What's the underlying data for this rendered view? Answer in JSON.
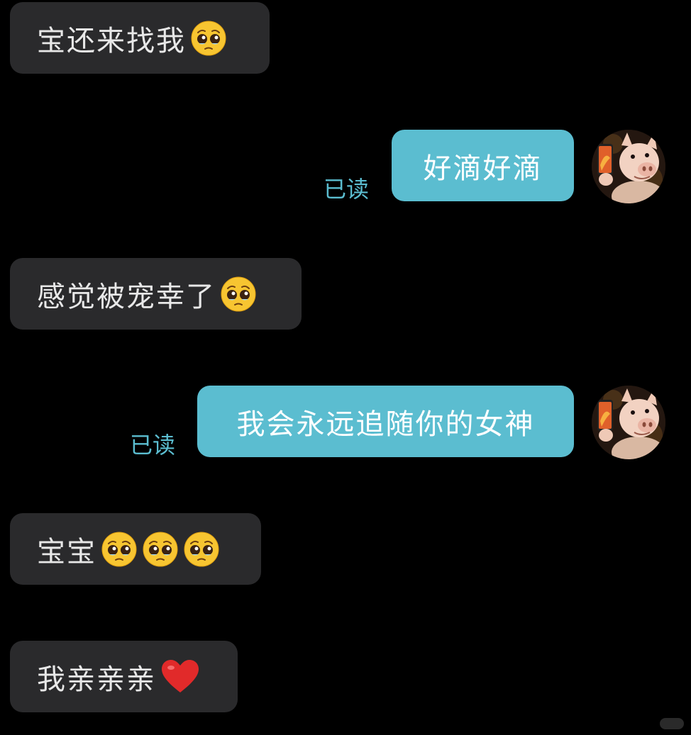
{
  "messages": [
    {
      "side": "in",
      "text": "宝还来找我",
      "emojis": [
        "pleading-face-emoji"
      ]
    },
    {
      "side": "out",
      "text": "好滴好滴",
      "status": "已读"
    },
    {
      "side": "in",
      "text": "感觉被宠幸了",
      "emojis": [
        "pleading-face-emoji"
      ]
    },
    {
      "side": "out",
      "text": "我会永远追随你的女神",
      "status": "已读"
    },
    {
      "side": "in",
      "text": "宝宝",
      "emojis": [
        "pleading-face-emoji",
        "pleading-face-emoji",
        "pleading-face-emoji"
      ]
    },
    {
      "side": "in",
      "text": "我亲亲亲",
      "emojis": [
        "red-heart-emoji"
      ]
    }
  ],
  "avatar": {
    "icon": "pig-holding-phone-avatar"
  },
  "colors": {
    "background": "#000000",
    "incoming_bubble": "#2a2a2c",
    "outgoing_bubble": "#5bbdd0",
    "read_status": "#5bbdd0"
  }
}
